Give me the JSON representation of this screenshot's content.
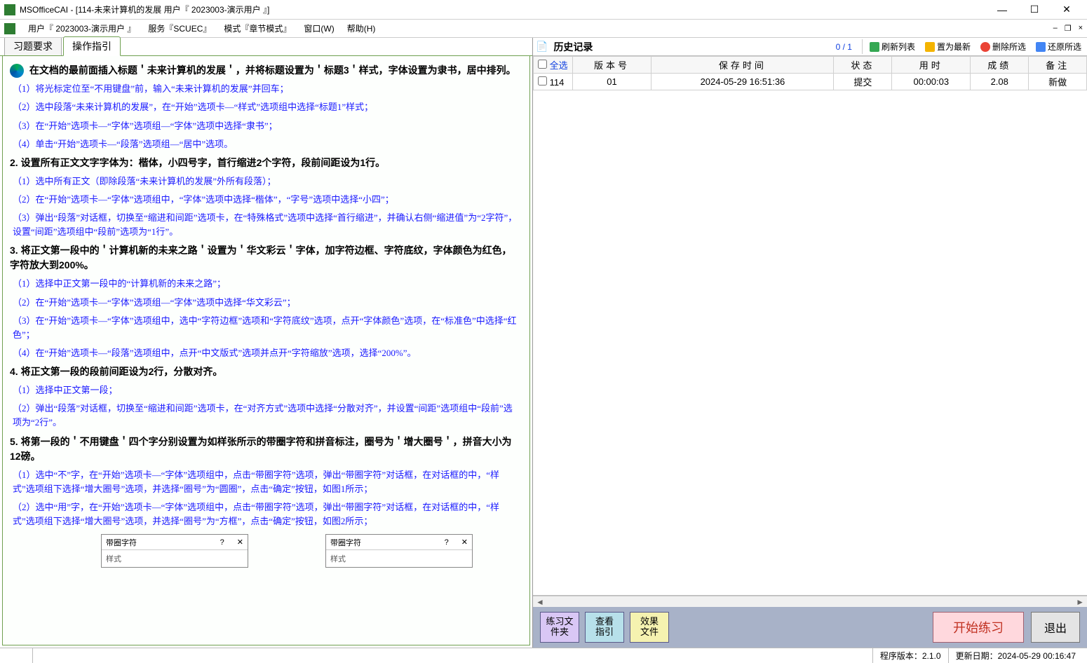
{
  "title": "MSOfficeCAI - [114-未来计算机的发展     用户『 2023003-演示用户 』]",
  "menu": {
    "user": "用户『 2023003-演示用户 』",
    "service": "服务『SCUEC』",
    "mode": "模式『章节模式』",
    "window": "窗口(W)",
    "help": "帮助(H)"
  },
  "tabs": {
    "req": "习题要求",
    "guide": "操作指引"
  },
  "sec1": {
    "head": "在文档的最前面插入标题＇未来计算机的发展＇，并将标题设置为＇标题3＇样式，字体设置为隶书，居中排列。",
    "s1": "（1）将光标定位至“不用键盘”前，输入“未来计算机的发展”并回车；",
    "s2": "（2）选中段落“未来计算机的发展”，在“开始”选项卡—“样式”选项组中选择“标题1”样式；",
    "s3": "（3）在“开始”选项卡—“字体”选项组—“字体”选项中选择“隶书”；",
    "s4": "（4）单击“开始”选项卡—“段落”选项组—“居中”选项。"
  },
  "sec2": {
    "head": "2.  设置所有正文文字字体为：楷体，小四号字，首行缩进2个字符，段前间距设为1行。",
    "s1": "（1）选中所有正文（即除段落“未来计算机的发展”外所有段落）；",
    "s2": "（2）在“开始”选项卡—“字体”选项组中，“字体”选项中选择“楷体”，“字号”选项中选择“小四”；",
    "s3": "（3）弹出“段落”对话框，切换至“缩进和间距”选项卡，在“特殊格式”选项中选择“首行缩进”，并确认右侧“缩进值”为“2字符”，设置“间距”选项组中“段前”选项为“1行”。"
  },
  "sec3": {
    "head": "3.  将正文第一段中的＇计算机新的未来之路＇设置为＇华文彩云＇字体，加字符边框、字符底纹，字体颜色为红色，字符放大到200%。",
    "s1": "（1）选择中正文第一段中的“计算机新的未来之路”；",
    "s2": "（2）在“开始”选项卡—“字体”选项组—“字体”选项中选择“华文彩云”；",
    "s3": "（3）在“开始”选项卡—“字体”选项组中，选中“字符边框”选项和“字符底纹”选项，点开“字体颜色”选项，在“标准色”中选择“红色”；",
    "s4": "（4）在“开始”选项卡—“段落”选项组中，点开“中文版式”选项并点开“字符缩放”选项，选择“200%”。"
  },
  "sec4": {
    "head": "4.  将正文第一段的段前间距设为2行，分散对齐。",
    "s1": "（1）选择中正文第一段；",
    "s2": "（2）弹出“段落”对话框，切换至“缩进和间距”选项卡，在“对齐方式”选项中选择“分散对齐”，并设置“间距”选项组中“段前”选项为“2行”。"
  },
  "sec5": {
    "head": "5.  将第一段的＇不用键盘＇四个字分别设置为如样张所示的带圈字符和拼音标注，圈号为＇增大圈号＇，拼音大小为12磅。",
    "s1": "（1）选中“不”字，在“开始”选项卡—“字体”选项组中，点击“带圈字符”选项，弹出“带圈字符”对话框，在对话框的中，“样式”选项组下选择“增大圈号”选项，并选择“圈号”为“圆圈”，点击“确定”按钮，如图1所示；",
    "s2": "（2）选中“用”字，在“开始”选项卡—“字体”选项组中，点击“带圈字符”选项，弹出“带圈字符”对话框，在对话框的中，“样式”选项组下选择“增大圈号”选项，并选择“圈号”为“方框”，点击“确定”按钮，如图2所示；"
  },
  "dlg": {
    "title": "带圈字符",
    "body": "样式"
  },
  "hist": {
    "title": "历史记录",
    "count": "0  /  1",
    "tools": {
      "refresh": "刷新列表",
      "latest": "置为最新",
      "delete": "删除所选",
      "restore": "还原所选"
    },
    "cols": {
      "sel": "全选",
      "no": "版本号",
      "time": "保存时间",
      "state": "状态",
      "dur": "用时",
      "score": "成绩",
      "remark": "备注"
    },
    "row": {
      "id": "114",
      "ver": "01",
      "time": "2024-05-29 16:51:36",
      "state": "提交",
      "dur": "00:00:03",
      "score": "2.08",
      "remark": "新做"
    }
  },
  "btns": {
    "folder": "练习文\n件夹",
    "guide": "查看\n指引",
    "effect": "效果\n文件",
    "start": "开始练习",
    "exit": "退出"
  },
  "status": {
    "ver": "程序版本：2.1.0",
    "date": "更新日期：2024-05-29 00:16:47"
  }
}
